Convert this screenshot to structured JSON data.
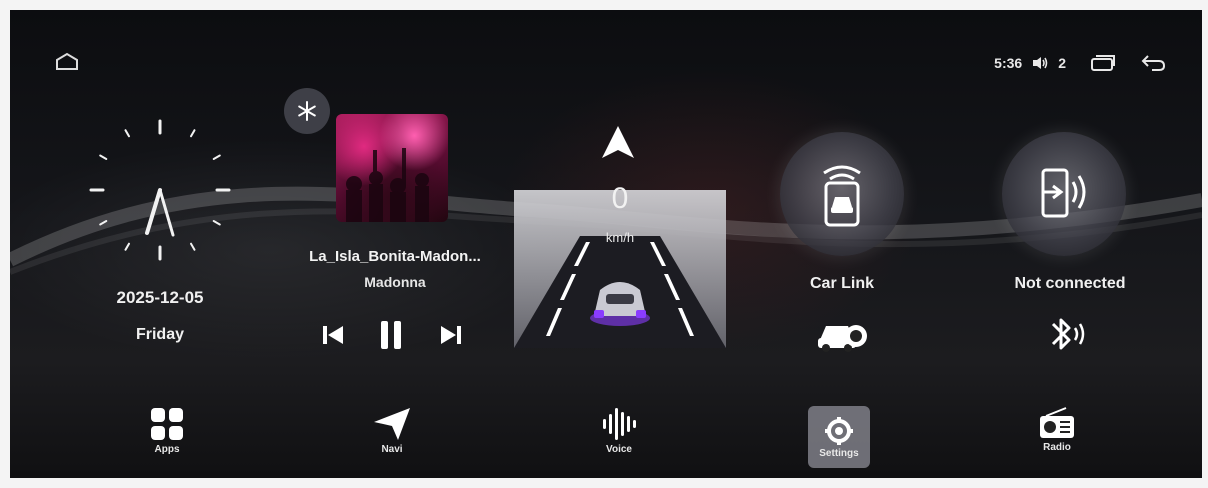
{
  "status_bar": {
    "time": "5:36",
    "volume": "2",
    "icons": [
      "home-icon",
      "volume-icon",
      "recent-apps-icon",
      "back-icon"
    ]
  },
  "clock": {
    "date": "2025-12-05",
    "day": "Friday"
  },
  "music": {
    "title": "La_Isla_Bonita-Madon...",
    "artist": "Madonna",
    "controls": [
      "snowflake-icon",
      "previous-icon",
      "pause-icon",
      "next-icon"
    ]
  },
  "speed": {
    "value": "0",
    "unit": "km/h"
  },
  "car_link": {
    "label": "Car Link"
  },
  "bluetooth": {
    "label": "Not connected"
  },
  "dock": [
    {
      "label": "Apps",
      "icon": "apps-icon"
    },
    {
      "label": "Navi",
      "icon": "navi-icon"
    },
    {
      "label": "Voice",
      "icon": "voice-icon"
    },
    {
      "label": "Settings",
      "icon": "gear-icon"
    },
    {
      "label": "Radio",
      "icon": "radio-icon"
    }
  ],
  "colors": {
    "accent_purple": "#8a3cff",
    "album_pink": "#e02a80"
  }
}
